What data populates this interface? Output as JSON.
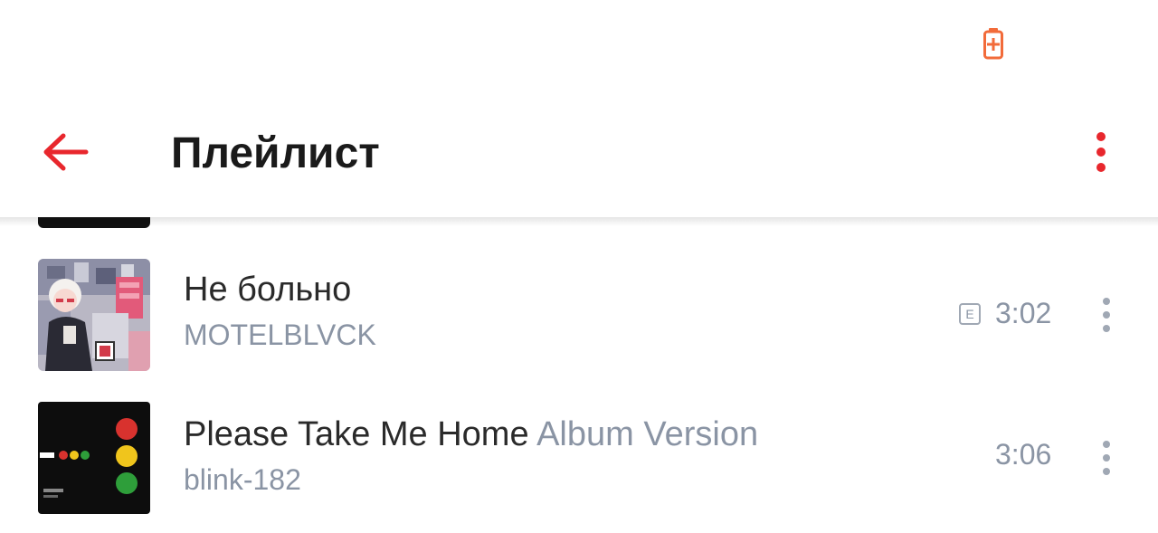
{
  "status_bar": {
    "battery_icon": "battery-charging-icon",
    "accent_color": "#f26b3a"
  },
  "toolbar": {
    "title": "Плейлист",
    "back_icon": "arrow-left-icon",
    "menu_icon": "more-vertical-icon",
    "accent_color": "#e8272d"
  },
  "tracks": [
    {
      "title": "Не больно",
      "version": "",
      "artist": "MOTELBLVCK",
      "explicit": true,
      "explicit_label": "E",
      "duration": "3:02",
      "cover_icon": "album-cover-art"
    },
    {
      "title": "Please Take Me Home",
      "version": "Album Version",
      "artist": "blink-182",
      "explicit": false,
      "duration": "3:06",
      "cover_icon": "album-cover-art"
    }
  ]
}
